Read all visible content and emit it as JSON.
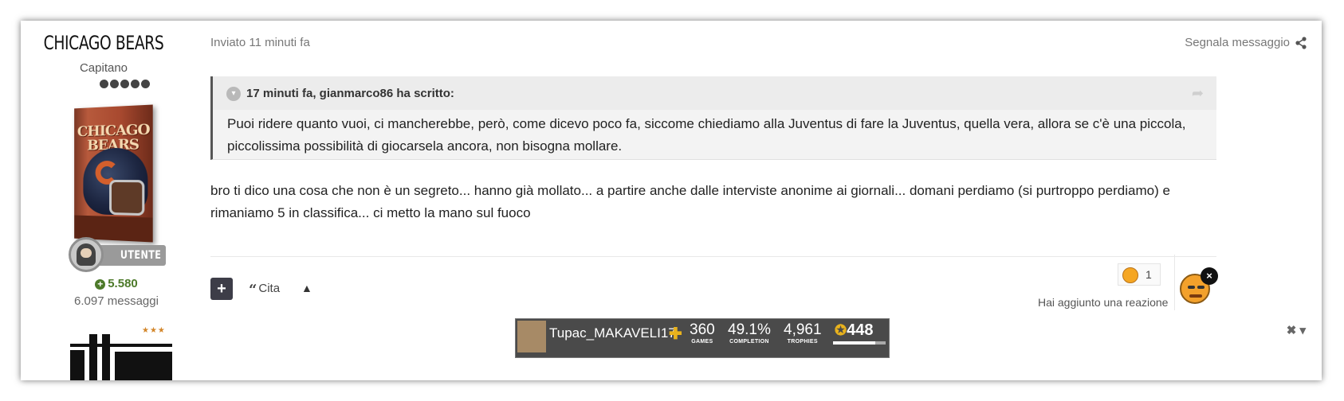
{
  "author": {
    "name": "CHICAGO BEARS",
    "rank": "Capitano",
    "pips": 5,
    "book_title": "CHICAGO BEARS",
    "badge_label": "UTENTE",
    "reputation": "5.580",
    "posts": "6.097 messaggi"
  },
  "post": {
    "posted": "Inviato 11 minuti fa",
    "report_label": "Segnala messaggio",
    "quote": {
      "citation": "17 minuti fa, gianmarco86 ha scritto:",
      "text": "Puoi ridere quanto vuoi, ci mancherebbe, però, come dicevo poco fa, siccome chiediamo alla Juventus di fare la Juventus, quella vera, allora se c'è una piccola, piccolissima possibilità di giocarsela ancora, non bisogna mollare."
    },
    "body": "bro ti dico una cosa che non è un segreto... hanno già mollato... a partire anche dalle interviste anonime ai giornali... domani perdiamo (si purtroppo perdiamo) e rimaniamo 5 in classifica... ci metto la mano sul fuoco"
  },
  "actions": {
    "plus_label": "+",
    "quote_label": "Cita",
    "up_label": "▲"
  },
  "reactions": {
    "count": "1",
    "note": "Hai aggiunto una reazione",
    "remove_label": "×"
  },
  "signature": {
    "psn_name": "Tupac_MAKAVELI17",
    "games": "360",
    "games_label": "GAMES",
    "completion": "49.1%",
    "completion_label": "COMPLETION",
    "trophies": "4,961",
    "trophies_label": "TROPHIES",
    "level": "448",
    "level_progress": 0.8,
    "tools_label": "✖ ▾"
  },
  "colors": {
    "reputation": "#4d7a2a",
    "accent_dark": "#3d3d48"
  }
}
